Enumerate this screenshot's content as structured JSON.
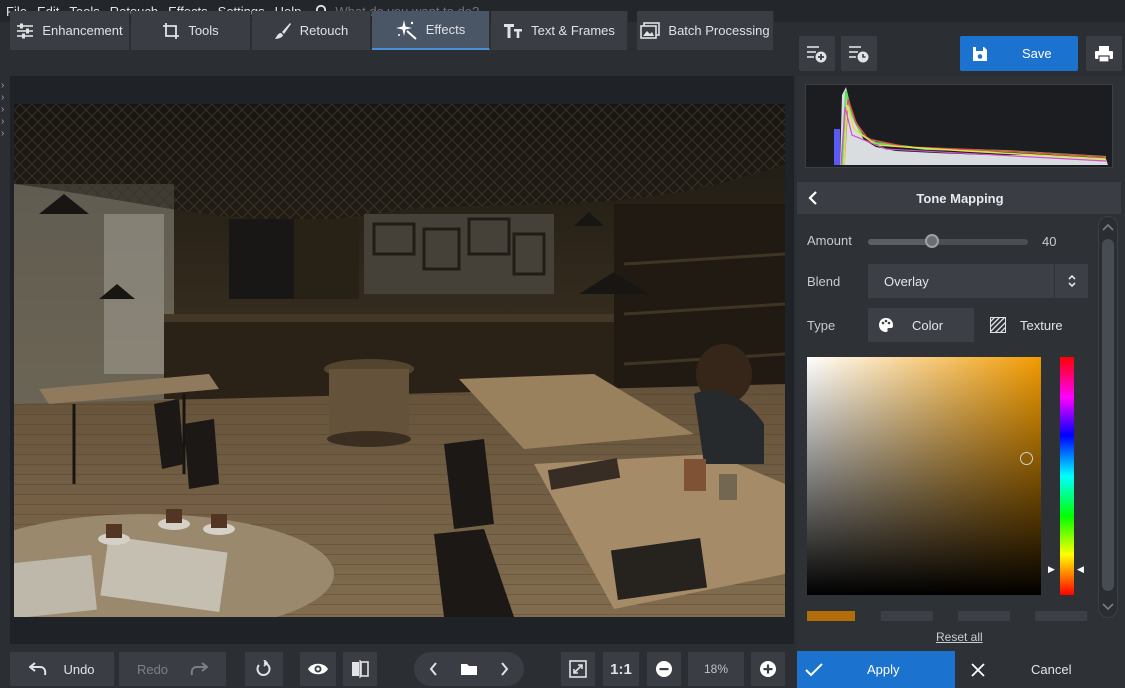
{
  "menu": {
    "items": [
      "File",
      "Edit",
      "Tools",
      "Retouch",
      "Effects",
      "Settings",
      "Help"
    ],
    "search_placeholder": "What do you want to do?"
  },
  "tabs": [
    {
      "label": "Enhancement",
      "icon": "sliders-icon"
    },
    {
      "label": "Tools",
      "icon": "crop-icon"
    },
    {
      "label": "Retouch",
      "icon": "brush-icon"
    },
    {
      "label": "Effects",
      "icon": "sparkle-icon",
      "active": true
    },
    {
      "label": "Text & Frames",
      "icon": "text-icon"
    },
    {
      "label": "Batch Processing",
      "icon": "images-icon"
    }
  ],
  "toolbar": {
    "save_label": "Save"
  },
  "panel": {
    "title": "Tone Mapping",
    "amount_label": "Amount",
    "amount_value": "40",
    "amount_fraction": 0.4,
    "blend_label": "Blend",
    "blend_value": "Overlay",
    "type_label": "Type",
    "type_color": "Color",
    "type_texture": "Texture",
    "reset_label": "Reset all",
    "picked_color": "#b06d0a"
  },
  "bottom": {
    "undo_label": "Undo",
    "redo_label": "Redo",
    "ratio_label": "1:1",
    "zoom_value": "18%"
  },
  "actions": {
    "apply_label": "Apply",
    "cancel_label": "Cancel"
  },
  "colors": {
    "accent": "#1c73cf",
    "active_tab": "#4a5565"
  }
}
